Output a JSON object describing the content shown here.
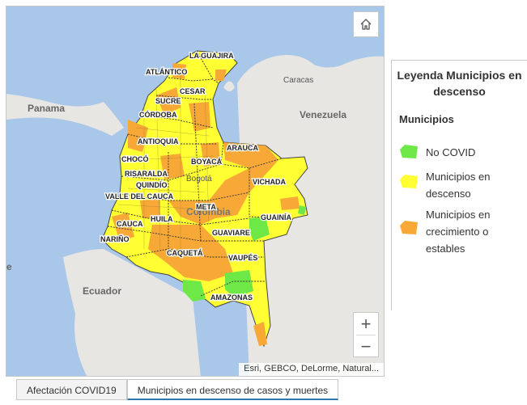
{
  "colors": {
    "no_covid": "#6ee847",
    "descenso": "#ffff33",
    "crecimiento": "#f7a836",
    "water": "#a9c7e8",
    "land": "#e8e6e2"
  },
  "map": {
    "countries": {
      "panama": "Panama",
      "venezuela": "Venezuela",
      "colombia": "Colombia",
      "ecuador": "Ecuador"
    },
    "cities": {
      "caracas": "Caracas",
      "bogota": "Bogotá"
    },
    "departments": {
      "la_guajira": "LA GUAJIRA",
      "atlantico": "ATLÁNTICO",
      "cesar": "CESAR",
      "sucre": "SUCRE",
      "cordoba": "CÓRDOBA",
      "antioquia": "ANTIOQUIA",
      "arauca": "ARAUCA",
      "boyaca": "BOYACÁ",
      "choco": "CHOCÓ",
      "vichada": "VICHADA",
      "risaralda": "RISARALDA",
      "quindio": "QUINDÍO",
      "valle": "VALLE DEL CAUCA",
      "meta": "META",
      "guainia": "GUAINÍA",
      "cauca": "CAUCA",
      "huila": "HUILA",
      "guaviare": "GUAVIARE",
      "narino": "NARIÑO",
      "caqueta": "CAQUETÁ",
      "vaupes": "VAUPÉS",
      "amazonas": "AMAZONAS"
    },
    "edge_letter": "e",
    "attribution": "Esri, GEBCO, DeLorme, Natural..."
  },
  "controls": {
    "home_icon": "home-icon",
    "zoom_in": "+",
    "zoom_out": "−"
  },
  "legend": {
    "title": "Leyenda Municipios en descenso",
    "layer": "Municipios",
    "items": [
      {
        "label": "No COVID",
        "color": "#6ee847"
      },
      {
        "label": "Municipios en descenso",
        "color": "#ffff33"
      },
      {
        "label": "Municipios en crecimiento o estables",
        "color": "#f7a836"
      }
    ]
  },
  "tabs": [
    {
      "label": "Afectación COVID19",
      "active": false
    },
    {
      "label": "Municipios en descenso de casos y muertes",
      "active": true
    }
  ]
}
